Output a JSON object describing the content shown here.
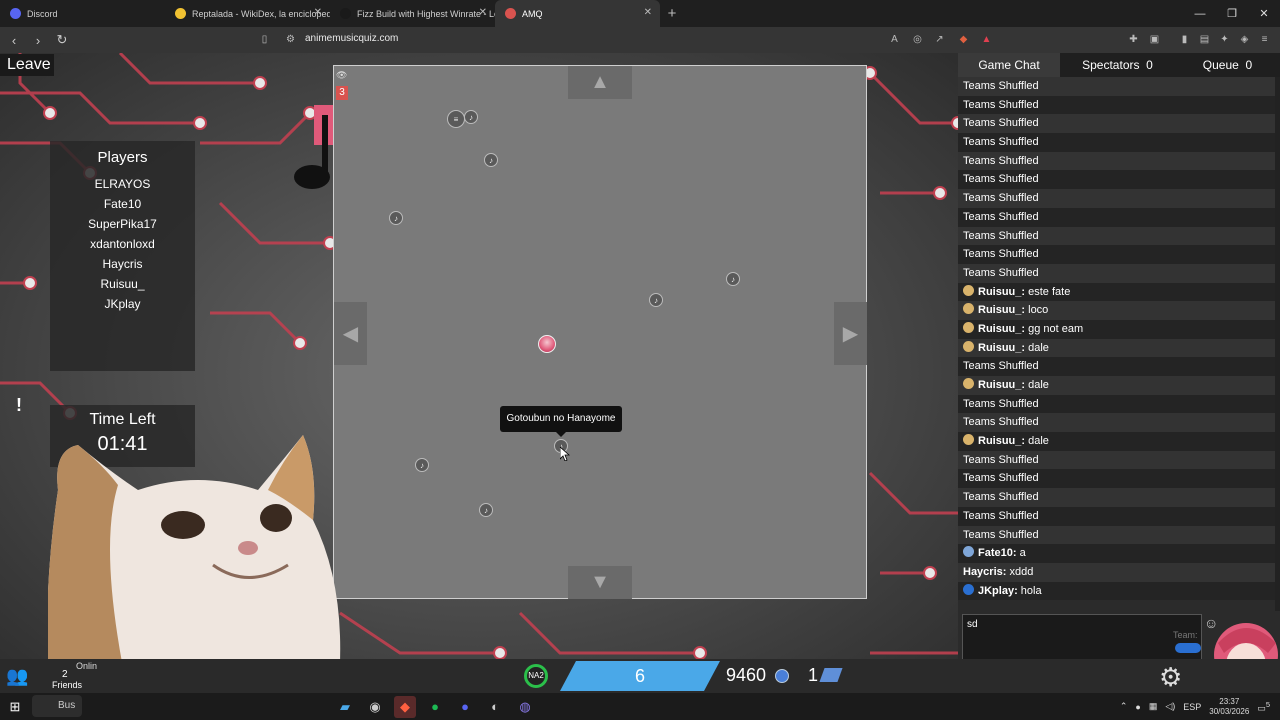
{
  "browser": {
    "tabs": [
      {
        "title": "Discord",
        "color": "#5865f2",
        "active": false,
        "closable": false
      },
      {
        "title": "Reptalada - WikiDex, la enciclopedia",
        "color": "#f1c232",
        "active": false,
        "closable": true
      },
      {
        "title": "Fizz Build with Highest Winrate - Lol",
        "color": "#1a1a1a",
        "active": false,
        "closable": true
      },
      {
        "title": "AMQ",
        "color": "#d9534f",
        "active": true,
        "closable": true
      }
    ],
    "new_tab": "+",
    "url": "animemusicquiz.com",
    "window_controls": [
      "—",
      "❐",
      "✕"
    ]
  },
  "game": {
    "leave_label": "Leave",
    "players_title": "Players",
    "players": [
      "ELRAYOS",
      "Fate10",
      "SuperPika17",
      "xdantonloxd",
      "Haycris",
      "Ruisuu_",
      "JKplay"
    ],
    "alert_label": "!",
    "time_left_label": "Time Left",
    "time_left_value": "01:41",
    "board": {
      "count_badge": "3",
      "tooltip": "Gotoubun no Hanayome"
    }
  },
  "chat": {
    "tabs": [
      {
        "label": "Game Chat",
        "count": ""
      },
      {
        "label": "Spectators",
        "count": "0"
      },
      {
        "label": "Queue",
        "count": "0"
      }
    ],
    "messages": [
      {
        "who": "",
        "text": "Teams Shuffled",
        "badge": ""
      },
      {
        "who": "",
        "text": "Teams Shuffled",
        "badge": ""
      },
      {
        "who": "",
        "text": "Teams Shuffled",
        "badge": ""
      },
      {
        "who": "",
        "text": "Teams Shuffled",
        "badge": ""
      },
      {
        "who": "",
        "text": "Teams Shuffled",
        "badge": ""
      },
      {
        "who": "",
        "text": "Teams Shuffled",
        "badge": ""
      },
      {
        "who": "",
        "text": "Teams Shuffled",
        "badge": ""
      },
      {
        "who": "",
        "text": "Teams Shuffled",
        "badge": ""
      },
      {
        "who": "",
        "text": "Teams Shuffled",
        "badge": ""
      },
      {
        "who": "",
        "text": "Teams Shuffled",
        "badge": ""
      },
      {
        "who": "",
        "text": "Teams Shuffled",
        "badge": ""
      },
      {
        "who": "Ruisuu_:",
        "text": " este fate",
        "badge": "#d9b36b"
      },
      {
        "who": "Ruisuu_:",
        "text": " loco",
        "badge": "#d9b36b"
      },
      {
        "who": "Ruisuu_:",
        "text": " gg not eam",
        "badge": "#d9b36b"
      },
      {
        "who": "Ruisuu_:",
        "text": " dale",
        "badge": "#d9b36b"
      },
      {
        "who": "",
        "text": "Teams Shuffled",
        "badge": ""
      },
      {
        "who": "Ruisuu_:",
        "text": " dale",
        "badge": "#d9b36b"
      },
      {
        "who": "",
        "text": "Teams Shuffled",
        "badge": ""
      },
      {
        "who": "",
        "text": "Teams Shuffled",
        "badge": ""
      },
      {
        "who": "Ruisuu_:",
        "text": " dale",
        "badge": "#d9b36b"
      },
      {
        "who": "",
        "text": "Teams Shuffled",
        "badge": ""
      },
      {
        "who": "",
        "text": "Teams Shuffled",
        "badge": ""
      },
      {
        "who": "",
        "text": "Teams Shuffled",
        "badge": ""
      },
      {
        "who": "",
        "text": "Teams Shuffled",
        "badge": ""
      },
      {
        "who": "",
        "text": "Teams Shuffled",
        "badge": ""
      },
      {
        "who": "Fate10:",
        "text": " a",
        "badge": "#7fa6d8"
      },
      {
        "who": "Haycris:",
        "text": " xddd",
        "badge": ""
      },
      {
        "who": "JKplay:",
        "text": " hola",
        "badge": "#2a6fd1"
      }
    ],
    "input_value": "sd",
    "team_label": "Team:"
  },
  "bottombar": {
    "online_label": "Onlin",
    "friends_count": "2",
    "friends_label": "Friends",
    "level_badge": "NA2",
    "level": "6",
    "points": "9460",
    "tickets": "1"
  },
  "taskbar": {
    "search_label": "Bus",
    "language": "ESP",
    "time": "23:37",
    "date": "30/03/2026",
    "notifications": "5"
  },
  "colors": {
    "accent": "#4aa8e8",
    "level_ring": "#2bbf4a",
    "circuit_red": "#c04050"
  }
}
